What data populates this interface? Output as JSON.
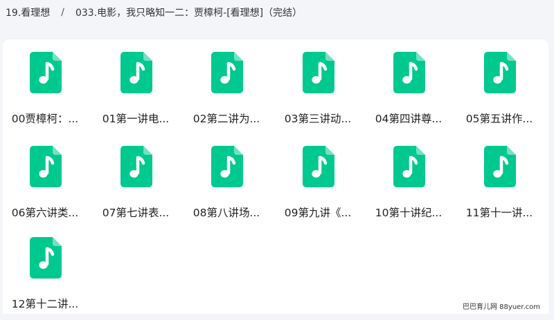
{
  "breadcrumb": {
    "parent": "19.看理想",
    "separator": "/",
    "current": "033.电影，我只略知一二：贾樟柯-[看理想]（完结）"
  },
  "icon_color": "#00c98f",
  "files": [
    {
      "name": "00贾樟柯：..."
    },
    {
      "name": "01第一讲电..."
    },
    {
      "name": "02第二讲为..."
    },
    {
      "name": "03第三讲动..."
    },
    {
      "name": "04第四讲尊..."
    },
    {
      "name": "05第五讲作..."
    },
    {
      "name": "06第六讲类..."
    },
    {
      "name": "07第七讲表..."
    },
    {
      "name": "08第八讲场..."
    },
    {
      "name": "09第九讲《..."
    },
    {
      "name": "10第十讲纪..."
    },
    {
      "name": "11第十一讲..."
    },
    {
      "name": "12第十二讲..."
    }
  ],
  "watermark": "巴巴育儿网 88yuer.com"
}
